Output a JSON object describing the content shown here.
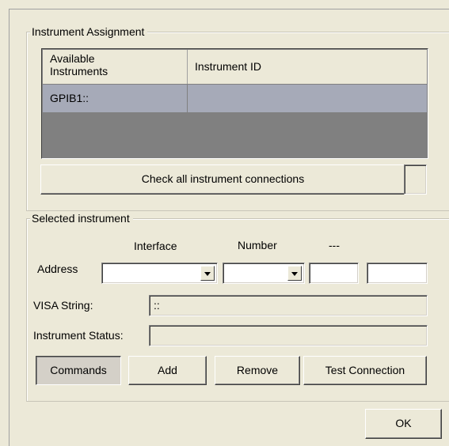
{
  "instrument_assignment": {
    "title": "Instrument Assignment",
    "columns": [
      "Available\nInstruments",
      "Instrument ID"
    ],
    "rows": [
      {
        "available": "GPIB1::",
        "instrument_id": ""
      }
    ],
    "check_all_label": "Check all instrument connections"
  },
  "selected_instrument": {
    "title": "Selected instrument",
    "headers": {
      "interface": "Interface",
      "number": "Number",
      "dots": "---"
    },
    "address_label": "Address",
    "interface_value": "",
    "number_value": "",
    "field3_value": "",
    "field4_value": "",
    "visa_label": "VISA String:",
    "visa_value": "::",
    "status_label": "Instrument Status:",
    "status_value": "",
    "buttons": {
      "commands": "Commands",
      "add": "Add",
      "remove": "Remove",
      "test": "Test Connection"
    }
  },
  "ok_label": "OK"
}
